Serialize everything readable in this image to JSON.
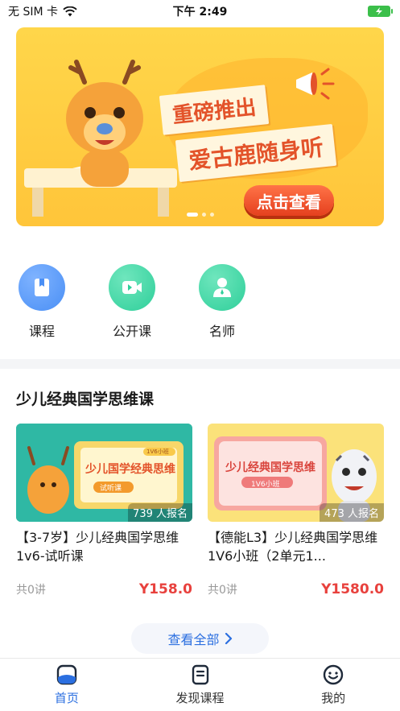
{
  "status_bar": {
    "carrier": "无 SIM 卡",
    "time": "下午 2:49"
  },
  "banner": {
    "line1": "重磅推出",
    "line2": "爱古鹿随身听",
    "cta": "点击查看"
  },
  "quick_links": [
    {
      "label": "课程",
      "icon": "book-icon",
      "color": "#4a8ff5"
    },
    {
      "label": "公开课",
      "icon": "video-icon",
      "color": "#2fcf9a"
    },
    {
      "label": "名师",
      "icon": "teacher-icon",
      "color": "#2fcf9a"
    }
  ],
  "section": {
    "title": "少儿经典国学思维课"
  },
  "courses": [
    {
      "thumb_title": "少儿国学经典思维",
      "thumb_tag": "试听课",
      "thumb_badge": "1V6小班",
      "enroll": "739 人报名",
      "title": "【3-7岁】少儿经典国学思维1v6-试听课",
      "lessons": "共0讲",
      "price": "Y158.0"
    },
    {
      "thumb_title": "少儿经典国学思维",
      "thumb_tag": "1V6小班",
      "enroll": "473 人报名",
      "title": "【德能L3】少儿经典国学思维1V6小班（2单元1...",
      "lessons": "共0讲",
      "price": "Y1580.0"
    }
  ],
  "view_all": "查看全部",
  "tabs": [
    {
      "label": "首页",
      "icon": "home-icon",
      "active": true
    },
    {
      "label": "发现课程",
      "icon": "document-icon",
      "active": false
    },
    {
      "label": "我的",
      "icon": "smile-icon",
      "active": false
    }
  ],
  "colors": {
    "accent": "#2b6fe0",
    "price": "#e8413d",
    "banner": "#ffc53a"
  }
}
